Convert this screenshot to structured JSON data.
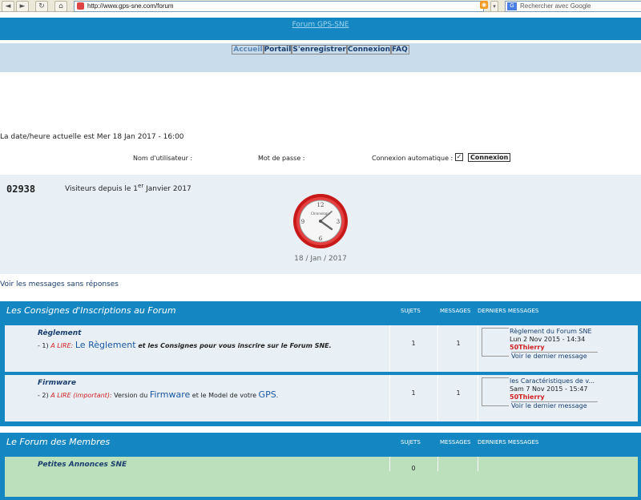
{
  "browser": {
    "url": "http://www.gps-sne.com/forum",
    "search_placeholder": "Rechercher avec Google",
    "rss_label": "rss"
  },
  "header": {
    "title": "Forum GPS-SNE"
  },
  "nav": [
    "Accueil",
    "Portail",
    "S'enregistrer",
    "Connexion",
    "FAQ"
  ],
  "datetime": "La date/heure actuelle est Mer 18 Jan 2017 - 16:00",
  "login": {
    "username_label": "Nom d'utilisateur :",
    "password_label": "Mot de passe :",
    "auto_label": "Connexion automatique :",
    "auto_checked": true,
    "button": "Connexion"
  },
  "visitors": {
    "count": "02938",
    "text_before": "Visiteurs depuis le 1",
    "sup": "er",
    "text_after": " Janvier 2017"
  },
  "clock": {
    "date": "18 / Jan / 2017",
    "face_text": "Chronologie"
  },
  "unanswered_link": "Voir les messages sans réponses",
  "colors": {
    "header": "#1487c2",
    "nav": "#c8dcec",
    "row": "#e8f0f6",
    "row_green": "#bde0bc",
    "red": "#d02020"
  },
  "categories": [
    {
      "title": "Les Consignes d'Inscriptions au Forum",
      "col_topics": "SUJETS",
      "col_messages": "MESSAGES",
      "col_last": "DERNIERS MESSAGES",
      "forums": [
        {
          "name": "Règlement",
          "desc_prefix": "- 1)",
          "desc_red": "A LIRE:",
          "desc_big": "Le Règlement",
          "desc_rest": " et les Consignes pour vous inscrire sur le Forum SNE.",
          "topics": "1",
          "messages": "1",
          "last_title": "Règlement du Forum SNE",
          "last_date": "Lun 2 Nov 2015 - 14:34",
          "last_author": "50Thierry",
          "last_view": "Voir le dernier message"
        },
        {
          "name": "Firmware",
          "desc_prefix": "- 2)",
          "desc_red": "A LIRE (important):",
          "desc_mid": " Version du ",
          "desc_big": "Firmware",
          "desc_mid2": " et le Model de votre ",
          "desc_big2": "GPS",
          "desc_end": ".",
          "topics": "1",
          "messages": "1",
          "last_title": "les Caractéristiques de v...",
          "last_date": "Sam 7 Nov 2015 - 15:47",
          "last_author": "50Thierry",
          "last_view": "Voir le dernier message"
        }
      ]
    },
    {
      "title": "Le Forum des Membres",
      "col_topics": "SUJETS",
      "col_messages": "MESSAGES",
      "col_last": "DERNIERS MESSAGES",
      "forums": [
        {
          "name": "Petites Annonces SNE",
          "topics": "0"
        }
      ]
    }
  ]
}
